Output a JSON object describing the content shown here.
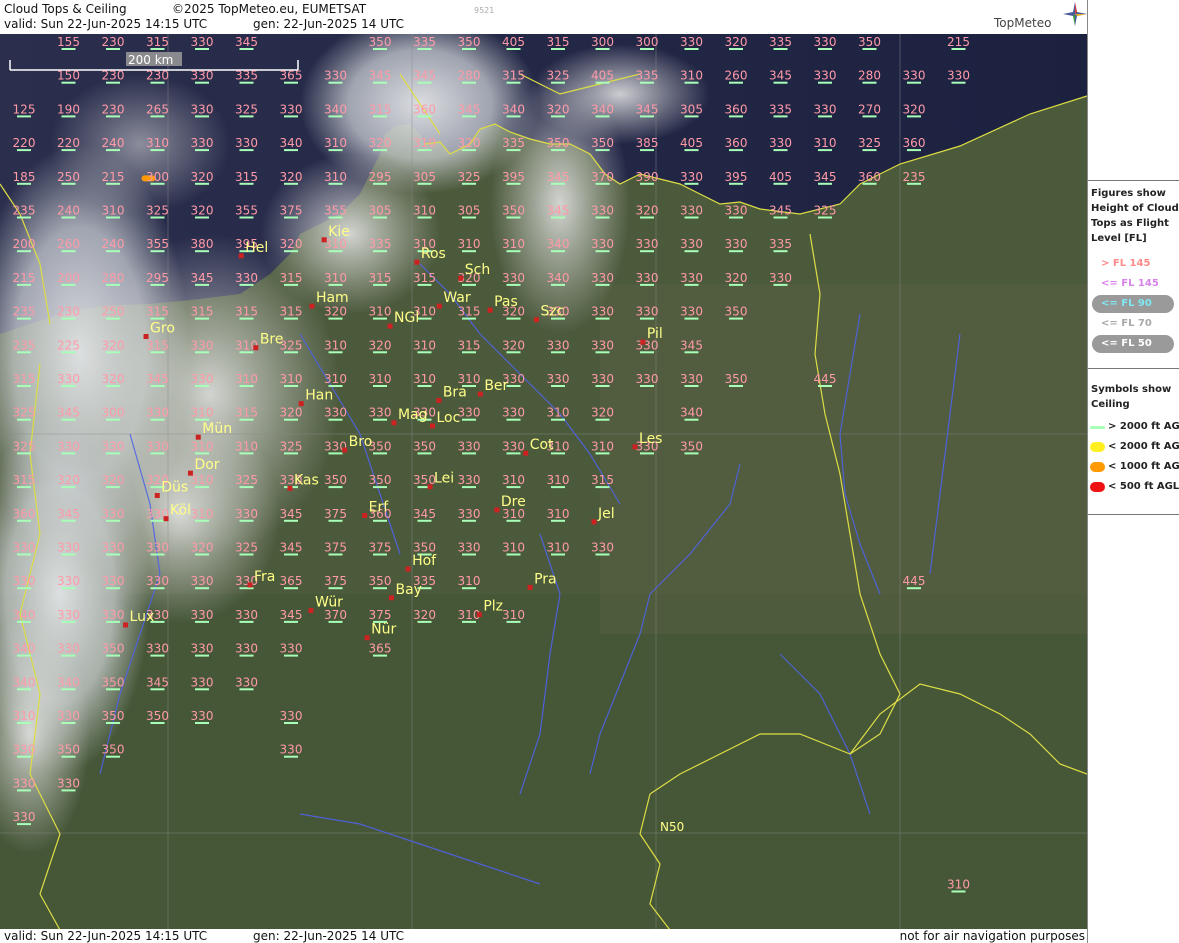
{
  "header": {
    "title": "Cloud Tops & Ceiling",
    "copyright": "©2025 TopMeteo.eu, EUMETSAT",
    "code": "9521",
    "valid": "valid:  Sun  22-Jun-2025  14:15 UTC",
    "gen": "gen: 22-Jun-2025 14 UTC",
    "brand": "TopMeteo"
  },
  "footer": {
    "valid": "valid:  Sun  22-Jun-2025  14:15 UTC",
    "gen": "gen: 22-Jun-2025 14 UTC",
    "disclaimer": "not for air navigation purposes"
  },
  "map": {
    "scale_label": "200 km",
    "grid_label": "N50",
    "colors": {
      "figure": "#ff9aa8",
      "city": "#ffff88",
      "city_dot": "#cc2222",
      "border": "#dddd44",
      "river": "#4f63e6",
      "ceiling": "#a8ffb8"
    },
    "cities": [
      {
        "name": "Kie",
        "lon": 10.2,
        "lat": 54.43
      },
      {
        "name": "Hel",
        "lon": 8.5,
        "lat": 54.23
      },
      {
        "name": "Ros",
        "lon": 12.1,
        "lat": 54.15
      },
      {
        "name": "Sch",
        "lon": 13.0,
        "lat": 53.95
      },
      {
        "name": "Ham",
        "lon": 9.95,
        "lat": 53.6
      },
      {
        "name": "War",
        "lon": 12.56,
        "lat": 53.6
      },
      {
        "name": "Pas",
        "lon": 13.6,
        "lat": 53.55
      },
      {
        "name": "Szc",
        "lon": 14.55,
        "lat": 53.43
      },
      {
        "name": "NGl",
        "lon": 11.55,
        "lat": 53.35
      },
      {
        "name": "Gro",
        "lon": 6.55,
        "lat": 53.22
      },
      {
        "name": "Bre",
        "lon": 8.8,
        "lat": 53.08
      },
      {
        "name": "Ber",
        "lon": 13.4,
        "lat": 52.5
      },
      {
        "name": "Bra",
        "lon": 12.55,
        "lat": 52.42
      },
      {
        "name": "Han",
        "lon": 9.73,
        "lat": 52.38
      },
      {
        "name": "Mag",
        "lon": 11.63,
        "lat": 52.14
      },
      {
        "name": "Loc",
        "lon": 12.42,
        "lat": 52.1
      },
      {
        "name": "Mün",
        "lon": 7.62,
        "lat": 51.96
      },
      {
        "name": "Cot",
        "lon": 14.33,
        "lat": 51.76
      },
      {
        "name": "Les",
        "lon": 16.57,
        "lat": 51.84
      },
      {
        "name": "Bro",
        "lon": 10.62,
        "lat": 51.8
      },
      {
        "name": "Dor",
        "lon": 7.46,
        "lat": 51.51
      },
      {
        "name": "Düs",
        "lon": 6.78,
        "lat": 51.23
      },
      {
        "name": "Kas",
        "lon": 9.5,
        "lat": 51.32
      },
      {
        "name": "Lei",
        "lon": 12.37,
        "lat": 51.34
      },
      {
        "name": "Erf",
        "lon": 11.03,
        "lat": 50.98
      },
      {
        "name": "Dre",
        "lon": 13.74,
        "lat": 51.05
      },
      {
        "name": "Köl",
        "lon": 6.96,
        "lat": 50.94
      },
      {
        "name": "Jel",
        "lon": 15.73,
        "lat": 50.9
      },
      {
        "name": "Hof",
        "lon": 11.92,
        "lat": 50.31
      },
      {
        "name": "Fra",
        "lon": 8.68,
        "lat": 50.11
      },
      {
        "name": "Bay",
        "lon": 11.58,
        "lat": 49.95
      },
      {
        "name": "Pra",
        "lon": 14.42,
        "lat": 50.08
      },
      {
        "name": "Wür",
        "lon": 9.93,
        "lat": 49.79
      },
      {
        "name": "Plz",
        "lon": 13.38,
        "lat": 49.74
      },
      {
        "name": "Lux",
        "lon": 6.13,
        "lat": 49.61
      },
      {
        "name": "Nür",
        "lon": 11.08,
        "lat": 49.45
      },
      {
        "name": "Pil",
        "lon": 16.73,
        "lat": 53.15
      }
    ],
    "cloud_rows": [
      [
        "",
        "155",
        "230",
        "315",
        "330",
        "345",
        "",
        "",
        "350",
        "335",
        "350",
        "405",
        "315",
        "300",
        "300",
        "330",
        "320",
        "335",
        "330",
        "350",
        "",
        "215"
      ],
      [
        "",
        "150",
        "230",
        "230",
        "330",
        "335",
        "365",
        "330",
        "345",
        "345",
        "280",
        "315",
        "325",
        "405",
        "335",
        "310",
        "260",
        "345",
        "330",
        "280",
        "330",
        "330"
      ],
      [
        "125",
        "190",
        "230",
        "265",
        "330",
        "325",
        "330",
        "340",
        "315",
        "360",
        "345",
        "340",
        "320",
        "340",
        "345",
        "305",
        "360",
        "335",
        "330",
        "270",
        "320",
        ""
      ],
      [
        "220",
        "220",
        "240",
        "310",
        "330",
        "330",
        "340",
        "310",
        "320",
        "310",
        "320",
        "335",
        "350",
        "350",
        "385",
        "405",
        "360",
        "330",
        "310",
        "325",
        "360",
        ""
      ],
      [
        "185",
        "250",
        "215",
        "300",
        "320",
        "315",
        "320",
        "310",
        "295",
        "305",
        "325",
        "395",
        "345",
        "370",
        "390",
        "330",
        "395",
        "405",
        "345",
        "360",
        "235",
        ""
      ],
      [
        "235",
        "240",
        "310",
        "325",
        "320",
        "355",
        "375",
        "355",
        "305",
        "310",
        "305",
        "350",
        "345",
        "330",
        "320",
        "330",
        "330",
        "345",
        "325",
        "",
        "",
        ""
      ],
      [
        "200",
        "260",
        "240",
        "355",
        "380",
        "395",
        "320",
        "310",
        "335",
        "310",
        "310",
        "310",
        "340",
        "330",
        "330",
        "330",
        "330",
        "335",
        "",
        "",
        "",
        ""
      ],
      [
        "215",
        "200",
        "280",
        "295",
        "345",
        "330",
        "315",
        "310",
        "315",
        "315",
        "320",
        "330",
        "340",
        "330",
        "330",
        "330",
        "320",
        "330",
        "",
        "",
        "",
        ""
      ],
      [
        "235",
        "230",
        "250",
        "315",
        "315",
        "315",
        "315",
        "320",
        "310",
        "310",
        "315",
        "320",
        "330",
        "330",
        "330",
        "330",
        "350",
        "",
        "",
        "",
        "",
        ""
      ],
      [
        "235",
        "225",
        "320",
        "315",
        "330",
        "310",
        "325",
        "310",
        "320",
        "310",
        "315",
        "320",
        "330",
        "330",
        "330",
        "345",
        "",
        "",
        "",
        "",
        "",
        ""
      ],
      [
        "315",
        "330",
        "320",
        "345",
        "330",
        "310",
        "310",
        "310",
        "310",
        "310",
        "310",
        "330",
        "330",
        "330",
        "330",
        "330",
        "350",
        "",
        "445",
        "",
        "",
        ""
      ],
      [
        "325",
        "345",
        "300",
        "330",
        "310",
        "315",
        "320",
        "330",
        "330",
        "330",
        "330",
        "330",
        "310",
        "320",
        "",
        "340",
        "",
        "",
        "",
        "",
        "",
        ""
      ],
      [
        "325",
        "330",
        "330",
        "330",
        "310",
        "310",
        "325",
        "330",
        "350",
        "350",
        "330",
        "330",
        "310",
        "310",
        "330",
        "350",
        "",
        "",
        "",
        "",
        "",
        ""
      ],
      [
        "315",
        "320",
        "320",
        "320",
        "310",
        "325",
        "330",
        "350",
        "350",
        "350",
        "330",
        "310",
        "310",
        "315",
        "",
        "",
        "",
        "",
        "",
        "",
        "",
        ""
      ],
      [
        "360",
        "345",
        "330",
        "330",
        "310",
        "330",
        "345",
        "375",
        "360",
        "345",
        "330",
        "310",
        "310",
        "",
        "",
        "",
        "",
        "",
        "",
        "",
        "",
        ""
      ],
      [
        "330",
        "330",
        "330",
        "330",
        "320",
        "325",
        "345",
        "375",
        "375",
        "350",
        "330",
        "310",
        "310",
        "330",
        "",
        "",
        "",
        "",
        "",
        "",
        "",
        ""
      ],
      [
        "330",
        "330",
        "330",
        "330",
        "330",
        "330",
        "365",
        "375",
        "350",
        "335",
        "310",
        "",
        "",
        "",
        "",
        "",
        "",
        "",
        "",
        "",
        "445",
        ""
      ],
      [
        "340",
        "330",
        "330",
        "330",
        "330",
        "330",
        "345",
        "370",
        "375",
        "320",
        "310",
        "310",
        "",
        "",
        "",
        "",
        "",
        "",
        "",
        "",
        "",
        ""
      ],
      [
        "340",
        "330",
        "350",
        "330",
        "330",
        "330",
        "330",
        "",
        "365",
        "",
        "",
        "",
        "",
        "",
        "",
        "",
        "",
        "",
        "",
        "",
        "",
        ""
      ],
      [
        "340",
        "340",
        "350",
        "345",
        "330",
        "330",
        "",
        "",
        "",
        "",
        "",
        "",
        "",
        "",
        "",
        "",
        "",
        "",
        "",
        "",
        "",
        ""
      ],
      [
        "310",
        "330",
        "350",
        "350",
        "330",
        "",
        "330",
        "",
        "",
        "",
        "",
        "",
        "",
        "",
        "",
        "",
        "",
        "",
        "",
        "",
        "",
        ""
      ],
      [
        "330",
        "350",
        "350",
        "",
        "",
        "",
        "330",
        "",
        "",
        "",
        "",
        "",
        "",
        "",
        "",
        "",
        "",
        "",
        "",
        "",
        "",
        ""
      ],
      [
        "330",
        "330",
        "",
        "",
        "",
        "",
        "",
        "",
        "",
        "",
        "",
        "",
        "",
        "",
        "",
        "",
        "",
        "",
        "",
        "",
        "",
        ""
      ],
      [
        "330",
        "",
        "",
        "",
        "",
        "",
        "",
        "",
        "",
        "",
        "",
        "",
        "",
        "",
        "",
        "",
        "",
        "",
        "",
        "",
        "",
        ""
      ],
      [
        "",
        "",
        "",
        "",
        "",
        "",
        "",
        "",
        "",
        "",
        "",
        "",
        "",
        "",
        "",
        "",
        "",
        "",
        "",
        "",
        "",
        ""
      ],
      [
        "",
        "",
        "",
        "",
        "",
        "",
        "",
        "",
        "",
        "",
        "",
        "",
        "",
        "",
        "",
        "",
        "",
        "",
        "",
        "",
        "",
        "310"
      ]
    ],
    "ceiling_marks": [
      {
        "lon": 6.6,
        "lat": 55.2,
        "level": "< 1000 ft AGL"
      }
    ]
  },
  "legend": {
    "figures_title": "Figures show Height of Cloud Tops as Flight Level  [FL]",
    "fl_items": [
      {
        "label": "> FL 145",
        "color": "#ff8a8a",
        "oval": false
      },
      {
        "label": "<= FL 145",
        "color": "#d783e8",
        "oval": false
      },
      {
        "label": "<= FL 90",
        "color": "#7fe8f2",
        "oval": true
      },
      {
        "label": "<= FL 70",
        "color": "#a8a8a8",
        "oval": false
      },
      {
        "label": "<= FL 50",
        "color": "#ffffff",
        "oval": true
      }
    ],
    "symbols_title": "Symbols show Ceiling",
    "ceiling_items": [
      {
        "label": "> 2000 ft AGL",
        "color": "#a8ffb8"
      },
      {
        "label": "< 2000 ft AGL",
        "color": "#ffee22"
      },
      {
        "label": "< 1000 ft AGL",
        "color": "#ff9900"
      },
      {
        "label": "< 500 ft AGL",
        "color": "#ee1111"
      }
    ]
  }
}
